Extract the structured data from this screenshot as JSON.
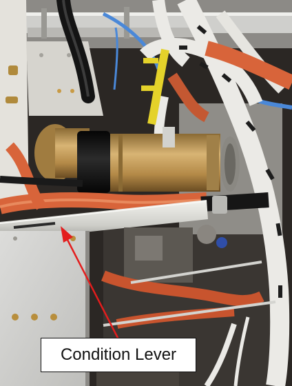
{
  "callout": {
    "label": "Condition Lever"
  },
  "colors": {
    "arrow": "#e31d1d",
    "hose_orange": "#d8643a",
    "harness_white": "#ebeae6",
    "compressor_gold": "#c8a060",
    "blue_line": "#4a88d8",
    "yellow_tape": "#e4d22a"
  }
}
